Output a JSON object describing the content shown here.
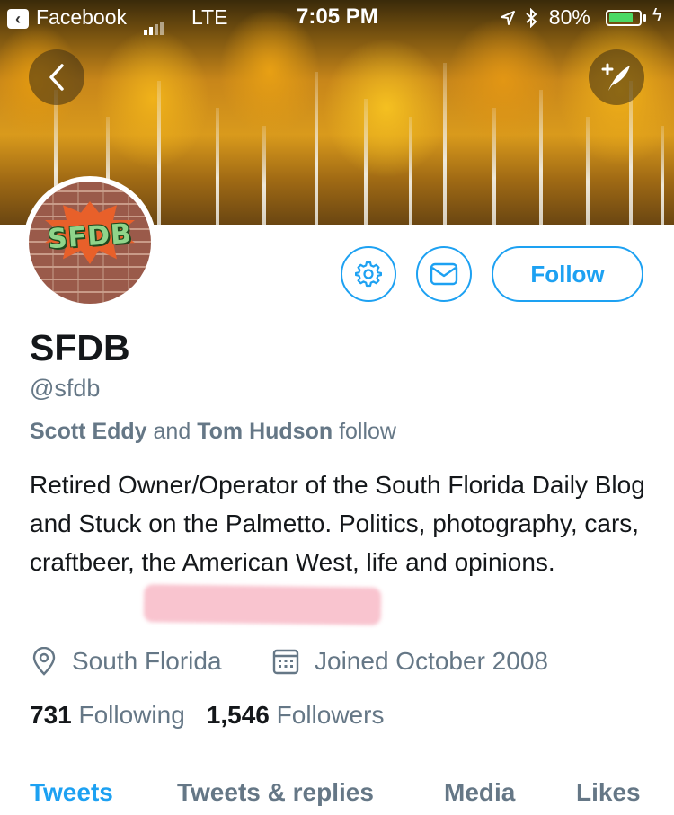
{
  "status_bar": {
    "back_app": "Facebook",
    "carrier": "LTE",
    "time": "7:05 PM",
    "battery": "80%",
    "battery_level": 0.8
  },
  "profile": {
    "avatar_text": "SFDB",
    "name": "SFDB",
    "handle": "@sfdb",
    "mutual": {
      "person1": "Scott Eddy",
      "conj": "and",
      "person2": "Tom Hudson",
      "suffix": "follow"
    },
    "bio": "Retired Owner/Operator of the South Florida Daily Blog and Stuck on the Palmetto. Politics, photography, cars, craftbeer, the American West, life and opinions.",
    "location": "South Florida",
    "joined": "Joined October 2008",
    "following_count": "731",
    "following_label": "Following",
    "followers_count": "1,546",
    "followers_label": "Followers"
  },
  "actions": {
    "follow_label": "Follow"
  },
  "tabs": [
    {
      "label": "Tweets"
    },
    {
      "label": "Tweets & replies"
    },
    {
      "label": "Media"
    },
    {
      "label": "Likes"
    }
  ],
  "colors": {
    "accent": "#1da1f2",
    "secondary_text": "#657786",
    "primary_text": "#14171a"
  }
}
